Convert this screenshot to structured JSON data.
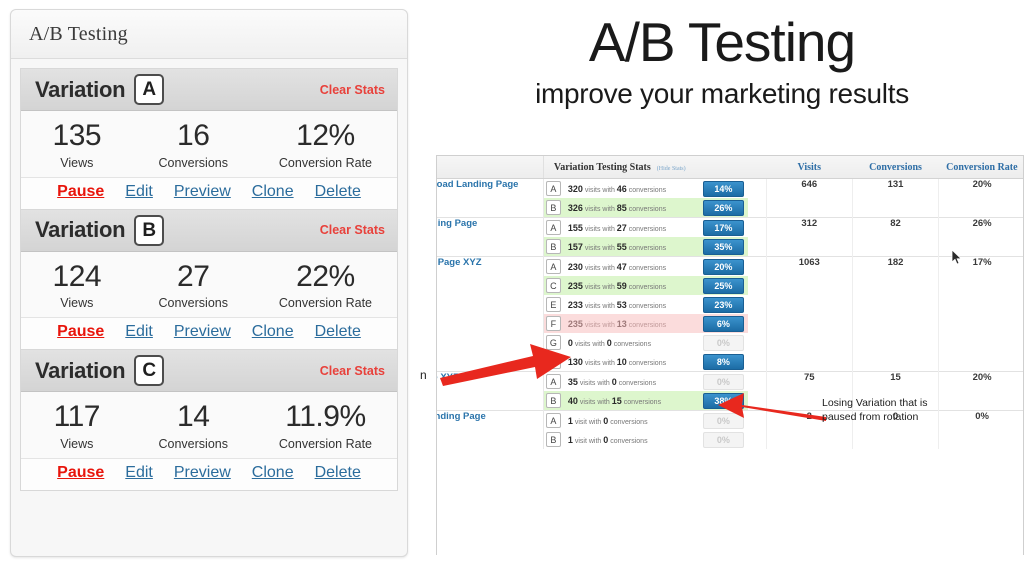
{
  "left_panel": {
    "title": "A/B Testing",
    "stat_labels": [
      "Views",
      "Conversions",
      "Conversion Rate"
    ],
    "clear_stats_label": "Clear Stats",
    "actions": [
      "Pause",
      "Edit",
      "Preview",
      "Clone",
      "Delete"
    ],
    "variation_word": "Variation",
    "variations": [
      {
        "letter": "A",
        "views": "135",
        "conversions": "16",
        "rate": "12%"
      },
      {
        "letter": "B",
        "views": "124",
        "conversions": "27",
        "rate": "22%"
      },
      {
        "letter": "C",
        "views": "117",
        "conversions": "14",
        "rate": "11.9%"
      }
    ]
  },
  "hero": {
    "title": "A/B Testing",
    "subtitle": "improve your marketing results"
  },
  "screenshot": {
    "headers": {
      "stats": "Variation Testing Stats",
      "hide_stats": "(Hide Stats)",
      "visits": "Visits",
      "conversions": "Conversions",
      "conversion_rate": "Conversion Rate"
    },
    "phrase_visits_with": "visits with",
    "phrase_visit_with": "visit with",
    "phrase_conversions": "conversions",
    "rows": [
      {
        "name": "ownload Landing Page",
        "visits": "646",
        "conversions": "131",
        "rate": "20%",
        "variations": [
          {
            "letter": "A",
            "visits": "320",
            "conversions": "46",
            "pct": "14%",
            "state": "normal"
          },
          {
            "letter": "B",
            "visits": "326",
            "conversions": "85",
            "pct": "26%",
            "state": "win"
          }
        ]
      },
      {
        "name": "Landing Page",
        "visits": "312",
        "conversions": "82",
        "rate": "26%",
        "variations": [
          {
            "letter": "A",
            "visits": "155",
            "conversions": "27",
            "pct": "17%",
            "state": "normal"
          },
          {
            "letter": "B",
            "visits": "157",
            "conversions": "55",
            "pct": "35%",
            "state": "win"
          }
        ]
      },
      {
        "name": "ding Page XYZ",
        "visits": "1063",
        "conversions": "182",
        "rate": "17%",
        "variations": [
          {
            "letter": "A",
            "visits": "230",
            "conversions": "47",
            "pct": "20%",
            "state": "normal"
          },
          {
            "letter": "C",
            "visits": "235",
            "conversions": "59",
            "pct": "25%",
            "state": "win"
          },
          {
            "letter": "E",
            "visits": "233",
            "conversions": "53",
            "pct": "23%",
            "state": "normal"
          },
          {
            "letter": "F",
            "visits": "235",
            "conversions": "13",
            "pct": "6%",
            "state": "lose"
          },
          {
            "letter": "G",
            "visits": "0",
            "conversions": "0",
            "pct": "0%",
            "state": "zero"
          },
          {
            "letter": "H",
            "visits": "130",
            "conversions": "10",
            "pct": "8%",
            "state": "normal"
          }
        ]
      },
      {
        "name": "Page XYZ",
        "visits": "75",
        "conversions": "15",
        "rate": "20%",
        "variations": [
          {
            "letter": "A",
            "visits": "35",
            "conversions": "0",
            "pct": "0%",
            "state": "zero"
          },
          {
            "letter": "B",
            "visits": "40",
            "conversions": "15",
            "pct": "38%",
            "state": "win"
          }
        ]
      },
      {
        "name": "p Landing Page",
        "visits": "2",
        "conversions": "0",
        "rate": "0%",
        "variations": [
          {
            "letter": "A",
            "visits": "1",
            "conversions": "0",
            "pct": "0%",
            "state": "zero",
            "singular": true
          },
          {
            "letter": "B",
            "visits": "1",
            "conversions": "0",
            "pct": "0%",
            "state": "zero",
            "singular": true
          }
        ]
      }
    ],
    "edge_fragment": "n",
    "callout": "Losing Variation that is paused from rotation"
  },
  "colors": {
    "accent_red": "#e8150c",
    "link_blue": "#2b6c9c",
    "clear_stats_red": "#e8413b",
    "badge_blue": "#2b86c5",
    "win_green": "#ddf6cd",
    "lose_pink": "#fbdcdc",
    "arrow_red": "#e8281e"
  }
}
